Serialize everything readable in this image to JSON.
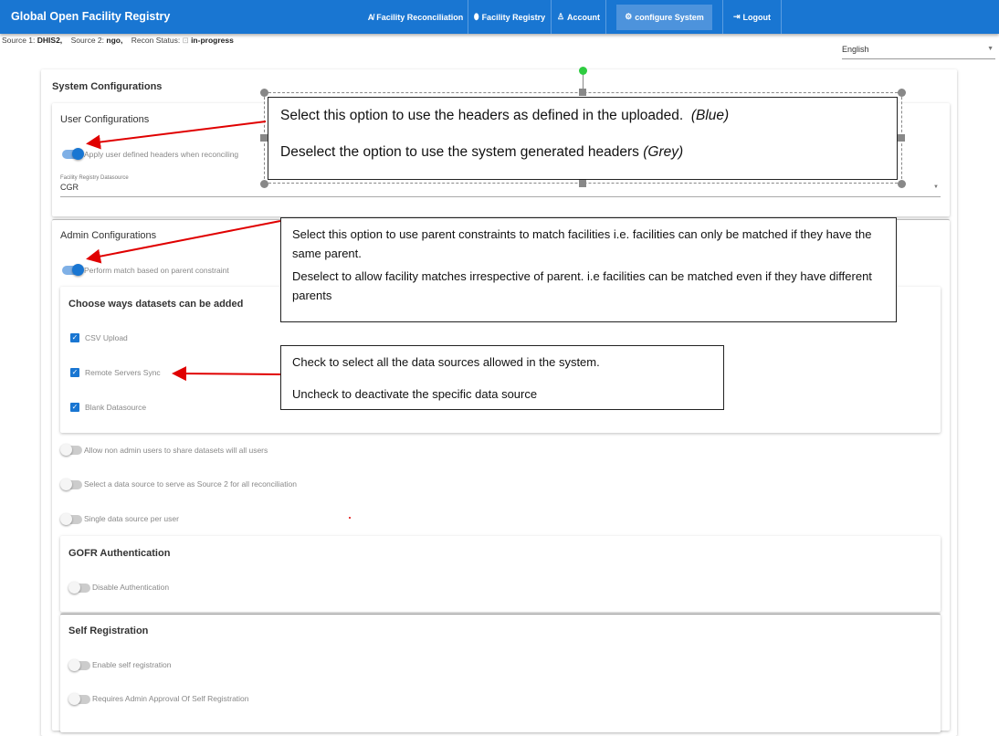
{
  "header": {
    "title": "Global Open Facility Registry",
    "nav": [
      {
        "label": "Facility Reconciliation",
        "icon": "spellcheck-icon"
      },
      {
        "label": "Facility Registry",
        "icon": "map-marker-icon"
      },
      {
        "label": "Account",
        "icon": "user-icon"
      },
      {
        "label": "configure System",
        "icon": "gear-icon",
        "active": true
      },
      {
        "label": "Logout",
        "icon": "logout-icon"
      }
    ],
    "color": "#1976d2"
  },
  "status": {
    "source1_label": "Source 1:",
    "source1": "DHIS2,",
    "source2_label": "Source 2:",
    "source2": "ngo,",
    "recon_label": "Recon Status:",
    "recon": "in-progress"
  },
  "language": {
    "value": "English"
  },
  "main": {
    "title": "System Configurations",
    "user_config": {
      "title": "User Configurations",
      "toggle": "Apply user defined headers when reconciling",
      "toggle_on": true,
      "datasource_label": "Facility Registry Datasource",
      "datasource_value": "CGR"
    },
    "admin_config": {
      "title": "Admin Configurations",
      "toggle": "Perform match based on parent constraint",
      "toggle_on": true,
      "ways": {
        "title": "Choose ways datasets can be added",
        "options": [
          {
            "label": "CSV Upload",
            "checked": true
          },
          {
            "label": "Remote Servers Sync",
            "checked": true
          },
          {
            "label": "Blank Datasource",
            "checked": true
          }
        ]
      },
      "toggles": [
        {
          "label": "Allow non admin users to share datasets will all users",
          "on": false
        },
        {
          "label": "Select a data source to serve as Source 2 for all reconciliation",
          "on": false
        },
        {
          "label": "Single data source per user",
          "on": false
        }
      ]
    },
    "auth": {
      "title": "GOFR Authentication",
      "toggle": "Disable Authentication",
      "on": false
    },
    "selfreg": {
      "title": "Self Registration",
      "toggles": [
        {
          "label": "Enable self registration",
          "on": false
        },
        {
          "label": "Requires Admin Approval Of Self Registration",
          "on": false
        }
      ]
    }
  },
  "notes": {
    "n1": {
      "l1": "Select this option to use the headers as defined in the uploaded.",
      "l1b": "(Blue)",
      "l2": "Deselect the option to use the system generated headers",
      "l2b": "(Grey)"
    },
    "n2": {
      "p1": "Select this option to use parent constraints to match facilities i.e. facilities can only be matched if they have the same parent.",
      "p2": "Deselect to allow facility matches irrespective of parent. i.e facilities can be matched even if they have different parents"
    },
    "n3": {
      "p1": "Check to select all the data sources allowed in the system.",
      "p2": "Uncheck to deactivate the specific data source"
    },
    "arrow_color": "#e00000"
  }
}
